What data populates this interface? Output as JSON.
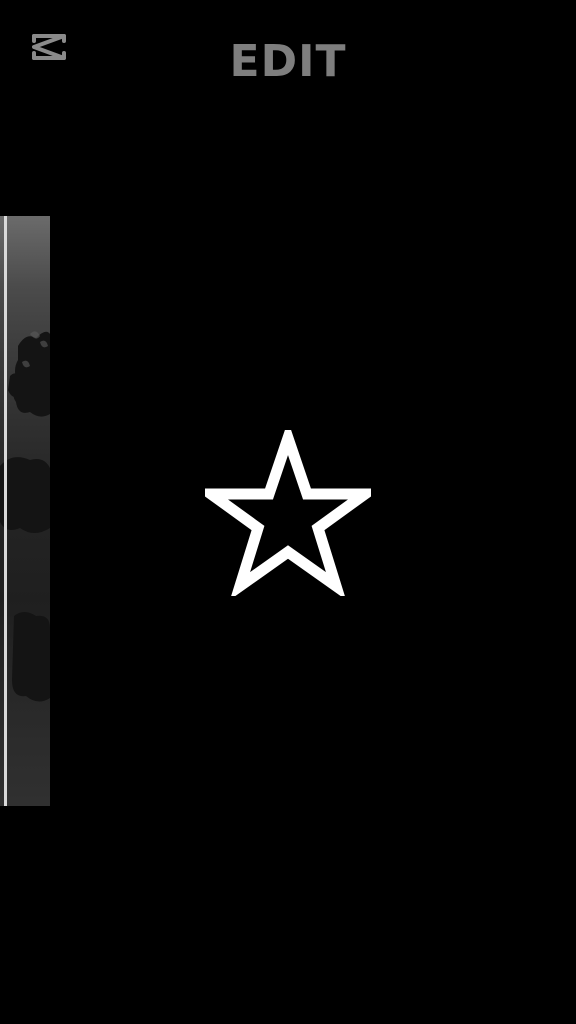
{
  "header": {
    "title": "EDIT",
    "logo_icon": "capcut-logo-icon",
    "title_color": "#7e7e7e"
  },
  "preview": {
    "clip_thumbnail": "video-clip-thumbnail",
    "center_icon": "star-outline-icon"
  },
  "colors": {
    "background": "#000000",
    "icon": "#ffffff"
  }
}
